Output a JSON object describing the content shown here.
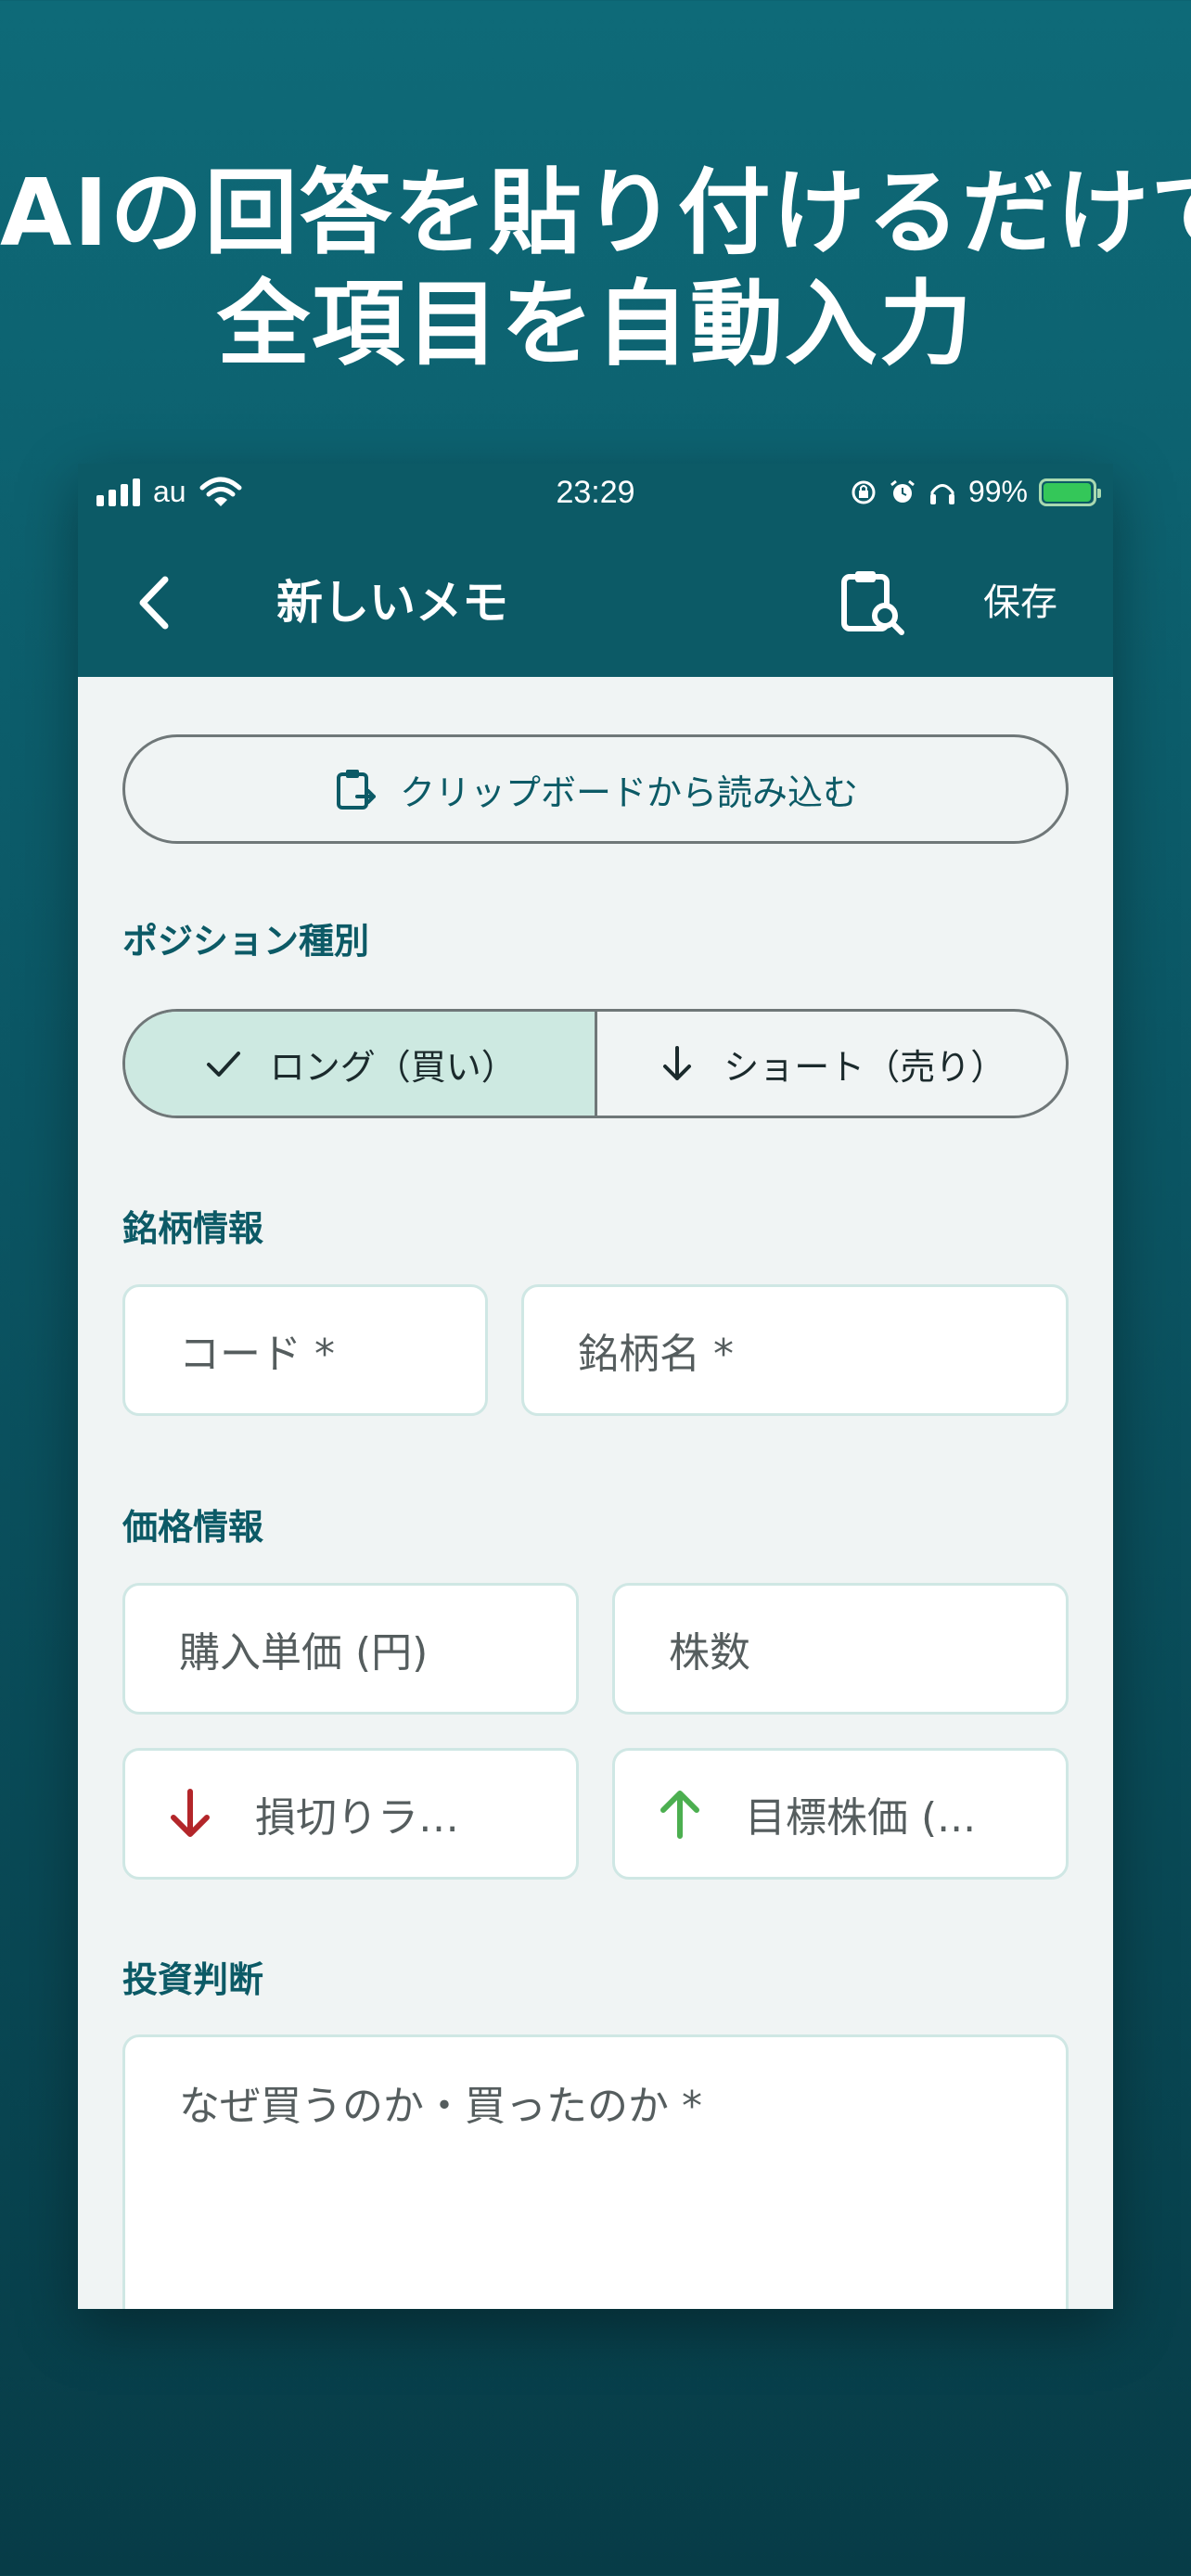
{
  "headline": {
    "line1": "AIの回答を貼り付けるだけで",
    "line2": "全項目を自動入力"
  },
  "status_bar": {
    "carrier": "au",
    "time": "23:29",
    "battery": "99%",
    "battery_level": 0.99
  },
  "nav": {
    "title": "新しいメモ",
    "save_label": "保存"
  },
  "clipboard_button": {
    "label": "クリップボードから読み込む"
  },
  "position_type": {
    "label": "ポジション種別",
    "options": [
      {
        "label": "ロング（買い）",
        "selected": true
      },
      {
        "label": "ショート（売り）",
        "selected": false
      }
    ]
  },
  "stock_info": {
    "label": "銘柄情報",
    "code_placeholder": "コード *",
    "name_placeholder": "銘柄名 *"
  },
  "price_info": {
    "label": "価格情報",
    "purchase_price_placeholder": "購入単価 (円)",
    "shares_placeholder": "株数",
    "stop_loss_placeholder": "損切りラ…",
    "target_price_placeholder": "目標株価 (..."
  },
  "investment_decision": {
    "label": "投資判断",
    "reason_placeholder": "なぜ買うのか・買ったのか *"
  },
  "colors": {
    "primary": "#0c5a66",
    "selected_segment": "#cde9e1",
    "stop_loss_red": "#b3262a",
    "target_green": "#4caf50"
  }
}
